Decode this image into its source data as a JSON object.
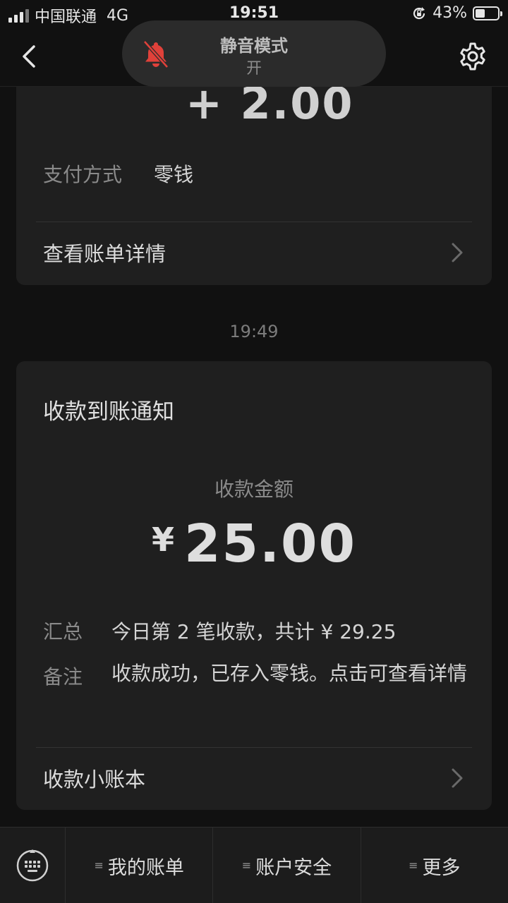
{
  "status_bar": {
    "carrier": "中国联通",
    "network": "4G",
    "time": "19:51",
    "battery_percent": "43%",
    "battery_level": 0.43,
    "icons": [
      "signal-icon",
      "rotation-lock-icon",
      "battery-icon"
    ]
  },
  "nav": {
    "back_icon": "chevron-left-icon",
    "settings_icon": "gear-icon"
  },
  "toast": {
    "title": "静音模式",
    "state": "开",
    "icon": "bell-slash-icon",
    "icon_color": "#e0413a"
  },
  "card_top": {
    "amount_partial": "+ 2.00",
    "payment_label": "支付方式",
    "payment_value": "零钱",
    "link_label": "查看账单详情"
  },
  "timestamp": "19:49",
  "card_receipt": {
    "title": "收款到账通知",
    "amount_label": "收款金额",
    "currency": "¥",
    "amount": "25.00",
    "summary_label": "汇总",
    "summary_value": "今日第 2 笔收款，共计 ¥ 29.25",
    "note_label": "备注",
    "note_value": "收款成功，已存入零钱。点击可查看详情",
    "link_label": "收款小账本"
  },
  "toolbar": {
    "keyboard_icon": "keyboard-icon",
    "items": [
      {
        "label": "我的账单"
      },
      {
        "label": "账户安全"
      },
      {
        "label": "更多"
      }
    ]
  },
  "colors": {
    "background": "#111111",
    "card": "#1f1f1f",
    "toast": "#2b2b2b"
  }
}
